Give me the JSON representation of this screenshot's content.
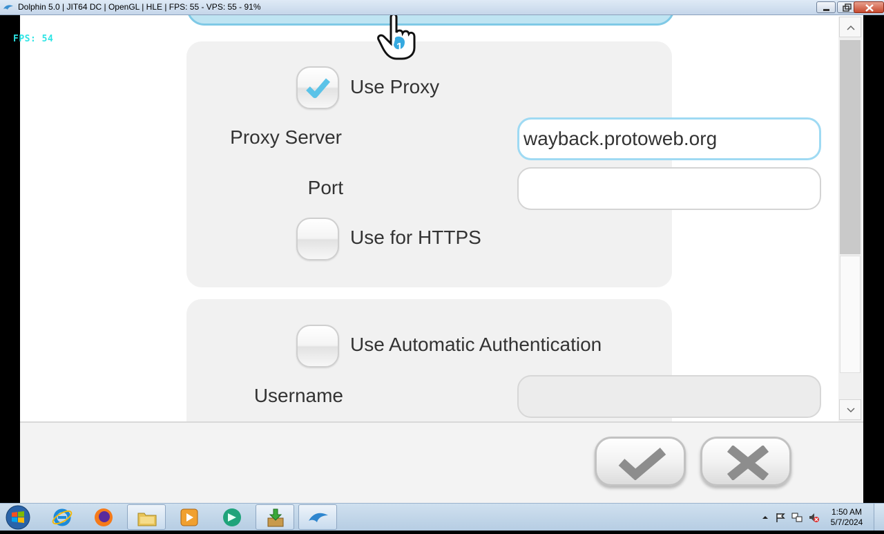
{
  "window": {
    "title": "Dolphin 5.0 | JIT64 DC | OpenGL | HLE | FPS: 55 - VPS: 55 - 91%",
    "buttons": [
      "minimize",
      "restore",
      "close"
    ]
  },
  "overlay": {
    "fps": "FPS: 54"
  },
  "cursor": {
    "player_number": "1"
  },
  "proxy_panel": {
    "use_proxy": {
      "label": "Use Proxy",
      "checked": true
    },
    "proxy_server": {
      "label": "Proxy Server",
      "value": "wayback.protoweb.org"
    },
    "port": {
      "label": "Port",
      "value": ""
    },
    "use_https": {
      "label": "Use for HTTPS",
      "checked": false
    }
  },
  "auth_panel": {
    "use_auto_auth": {
      "label": "Use Automatic Authentication",
      "checked": false
    },
    "username": {
      "label": "Username",
      "value": ""
    }
  },
  "actions": {
    "confirm_icon": "checkmark-icon",
    "cancel_icon": "x-icon"
  },
  "taskbar": {
    "apps": [
      "internet-explorer-icon",
      "firefox-icon",
      "file-explorer-icon",
      "media-player-icon",
      "chat-app-icon",
      "installer-icon",
      "dolphin-icon"
    ],
    "clock": {
      "time": "1:50 AM",
      "date": "5/7/2024"
    }
  },
  "colors": {
    "accent": "#9fdaf3",
    "fps_text": "#2de4e4",
    "checkmark": "#5bc3e8"
  }
}
